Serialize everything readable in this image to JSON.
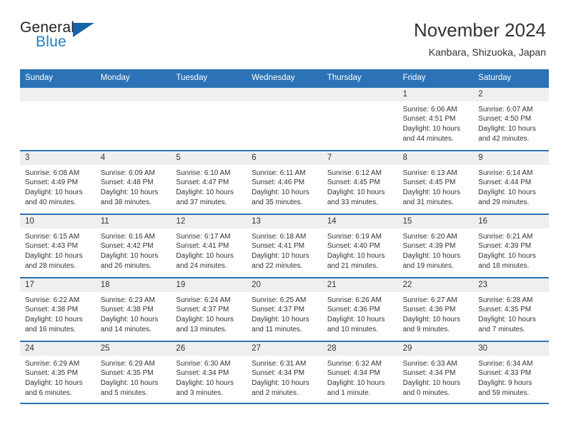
{
  "brand": {
    "name_part1": "General",
    "name_part2": "Blue",
    "triangle_color": "#1763a8",
    "blue_text_color": "#1f7ac4"
  },
  "header": {
    "title": "November 2024",
    "subtitle": "Kanbara, Shizuoka, Japan",
    "header_bg_color": "#2b72b6",
    "daynum_band_color": "#efefef"
  },
  "weekdays": [
    "Sunday",
    "Monday",
    "Tuesday",
    "Wednesday",
    "Thursday",
    "Friday",
    "Saturday"
  ],
  "weeks": [
    [
      {
        "day": "",
        "sunrise": "",
        "sunset": "",
        "daylight_line1": "",
        "daylight_line2": "",
        "empty": true
      },
      {
        "day": "",
        "sunrise": "",
        "sunset": "",
        "daylight_line1": "",
        "daylight_line2": "",
        "empty": true
      },
      {
        "day": "",
        "sunrise": "",
        "sunset": "",
        "daylight_line1": "",
        "daylight_line2": "",
        "empty": true
      },
      {
        "day": "",
        "sunrise": "",
        "sunset": "",
        "daylight_line1": "",
        "daylight_line2": "",
        "empty": true
      },
      {
        "day": "",
        "sunrise": "",
        "sunset": "",
        "daylight_line1": "",
        "daylight_line2": "",
        "empty": true
      },
      {
        "day": "1",
        "sunrise": "Sunrise: 6:06 AM",
        "sunset": "Sunset: 4:51 PM",
        "daylight_line1": "Daylight: 10 hours",
        "daylight_line2": "and 44 minutes."
      },
      {
        "day": "2",
        "sunrise": "Sunrise: 6:07 AM",
        "sunset": "Sunset: 4:50 PM",
        "daylight_line1": "Daylight: 10 hours",
        "daylight_line2": "and 42 minutes."
      }
    ],
    [
      {
        "day": "3",
        "sunrise": "Sunrise: 6:08 AM",
        "sunset": "Sunset: 4:49 PM",
        "daylight_line1": "Daylight: 10 hours",
        "daylight_line2": "and 40 minutes."
      },
      {
        "day": "4",
        "sunrise": "Sunrise: 6:09 AM",
        "sunset": "Sunset: 4:48 PM",
        "daylight_line1": "Daylight: 10 hours",
        "daylight_line2": "and 38 minutes."
      },
      {
        "day": "5",
        "sunrise": "Sunrise: 6:10 AM",
        "sunset": "Sunset: 4:47 PM",
        "daylight_line1": "Daylight: 10 hours",
        "daylight_line2": "and 37 minutes."
      },
      {
        "day": "6",
        "sunrise": "Sunrise: 6:11 AM",
        "sunset": "Sunset: 4:46 PM",
        "daylight_line1": "Daylight: 10 hours",
        "daylight_line2": "and 35 minutes."
      },
      {
        "day": "7",
        "sunrise": "Sunrise: 6:12 AM",
        "sunset": "Sunset: 4:45 PM",
        "daylight_line1": "Daylight: 10 hours",
        "daylight_line2": "and 33 minutes."
      },
      {
        "day": "8",
        "sunrise": "Sunrise: 6:13 AM",
        "sunset": "Sunset: 4:45 PM",
        "daylight_line1": "Daylight: 10 hours",
        "daylight_line2": "and 31 minutes."
      },
      {
        "day": "9",
        "sunrise": "Sunrise: 6:14 AM",
        "sunset": "Sunset: 4:44 PM",
        "daylight_line1": "Daylight: 10 hours",
        "daylight_line2": "and 29 minutes."
      }
    ],
    [
      {
        "day": "10",
        "sunrise": "Sunrise: 6:15 AM",
        "sunset": "Sunset: 4:43 PM",
        "daylight_line1": "Daylight: 10 hours",
        "daylight_line2": "and 28 minutes."
      },
      {
        "day": "11",
        "sunrise": "Sunrise: 6:16 AM",
        "sunset": "Sunset: 4:42 PM",
        "daylight_line1": "Daylight: 10 hours",
        "daylight_line2": "and 26 minutes."
      },
      {
        "day": "12",
        "sunrise": "Sunrise: 6:17 AM",
        "sunset": "Sunset: 4:41 PM",
        "daylight_line1": "Daylight: 10 hours",
        "daylight_line2": "and 24 minutes."
      },
      {
        "day": "13",
        "sunrise": "Sunrise: 6:18 AM",
        "sunset": "Sunset: 4:41 PM",
        "daylight_line1": "Daylight: 10 hours",
        "daylight_line2": "and 22 minutes."
      },
      {
        "day": "14",
        "sunrise": "Sunrise: 6:19 AM",
        "sunset": "Sunset: 4:40 PM",
        "daylight_line1": "Daylight: 10 hours",
        "daylight_line2": "and 21 minutes."
      },
      {
        "day": "15",
        "sunrise": "Sunrise: 6:20 AM",
        "sunset": "Sunset: 4:39 PM",
        "daylight_line1": "Daylight: 10 hours",
        "daylight_line2": "and 19 minutes."
      },
      {
        "day": "16",
        "sunrise": "Sunrise: 6:21 AM",
        "sunset": "Sunset: 4:39 PM",
        "daylight_line1": "Daylight: 10 hours",
        "daylight_line2": "and 18 minutes."
      }
    ],
    [
      {
        "day": "17",
        "sunrise": "Sunrise: 6:22 AM",
        "sunset": "Sunset: 4:38 PM",
        "daylight_line1": "Daylight: 10 hours",
        "daylight_line2": "and 16 minutes."
      },
      {
        "day": "18",
        "sunrise": "Sunrise: 6:23 AM",
        "sunset": "Sunset: 4:38 PM",
        "daylight_line1": "Daylight: 10 hours",
        "daylight_line2": "and 14 minutes."
      },
      {
        "day": "19",
        "sunrise": "Sunrise: 6:24 AM",
        "sunset": "Sunset: 4:37 PM",
        "daylight_line1": "Daylight: 10 hours",
        "daylight_line2": "and 13 minutes."
      },
      {
        "day": "20",
        "sunrise": "Sunrise: 6:25 AM",
        "sunset": "Sunset: 4:37 PM",
        "daylight_line1": "Daylight: 10 hours",
        "daylight_line2": "and 11 minutes."
      },
      {
        "day": "21",
        "sunrise": "Sunrise: 6:26 AM",
        "sunset": "Sunset: 4:36 PM",
        "daylight_line1": "Daylight: 10 hours",
        "daylight_line2": "and 10 minutes."
      },
      {
        "day": "22",
        "sunrise": "Sunrise: 6:27 AM",
        "sunset": "Sunset: 4:36 PM",
        "daylight_line1": "Daylight: 10 hours",
        "daylight_line2": "and 9 minutes."
      },
      {
        "day": "23",
        "sunrise": "Sunrise: 6:28 AM",
        "sunset": "Sunset: 4:35 PM",
        "daylight_line1": "Daylight: 10 hours",
        "daylight_line2": "and 7 minutes."
      }
    ],
    [
      {
        "day": "24",
        "sunrise": "Sunrise: 6:29 AM",
        "sunset": "Sunset: 4:35 PM",
        "daylight_line1": "Daylight: 10 hours",
        "daylight_line2": "and 6 minutes."
      },
      {
        "day": "25",
        "sunrise": "Sunrise: 6:29 AM",
        "sunset": "Sunset: 4:35 PM",
        "daylight_line1": "Daylight: 10 hours",
        "daylight_line2": "and 5 minutes."
      },
      {
        "day": "26",
        "sunrise": "Sunrise: 6:30 AM",
        "sunset": "Sunset: 4:34 PM",
        "daylight_line1": "Daylight: 10 hours",
        "daylight_line2": "and 3 minutes."
      },
      {
        "day": "27",
        "sunrise": "Sunrise: 6:31 AM",
        "sunset": "Sunset: 4:34 PM",
        "daylight_line1": "Daylight: 10 hours",
        "daylight_line2": "and 2 minutes."
      },
      {
        "day": "28",
        "sunrise": "Sunrise: 6:32 AM",
        "sunset": "Sunset: 4:34 PM",
        "daylight_line1": "Daylight: 10 hours",
        "daylight_line2": "and 1 minute."
      },
      {
        "day": "29",
        "sunrise": "Sunrise: 6:33 AM",
        "sunset": "Sunset: 4:34 PM",
        "daylight_line1": "Daylight: 10 hours",
        "daylight_line2": "and 0 minutes."
      },
      {
        "day": "30",
        "sunrise": "Sunrise: 6:34 AM",
        "sunset": "Sunset: 4:33 PM",
        "daylight_line1": "Daylight: 9 hours",
        "daylight_line2": "and 59 minutes."
      }
    ]
  ]
}
